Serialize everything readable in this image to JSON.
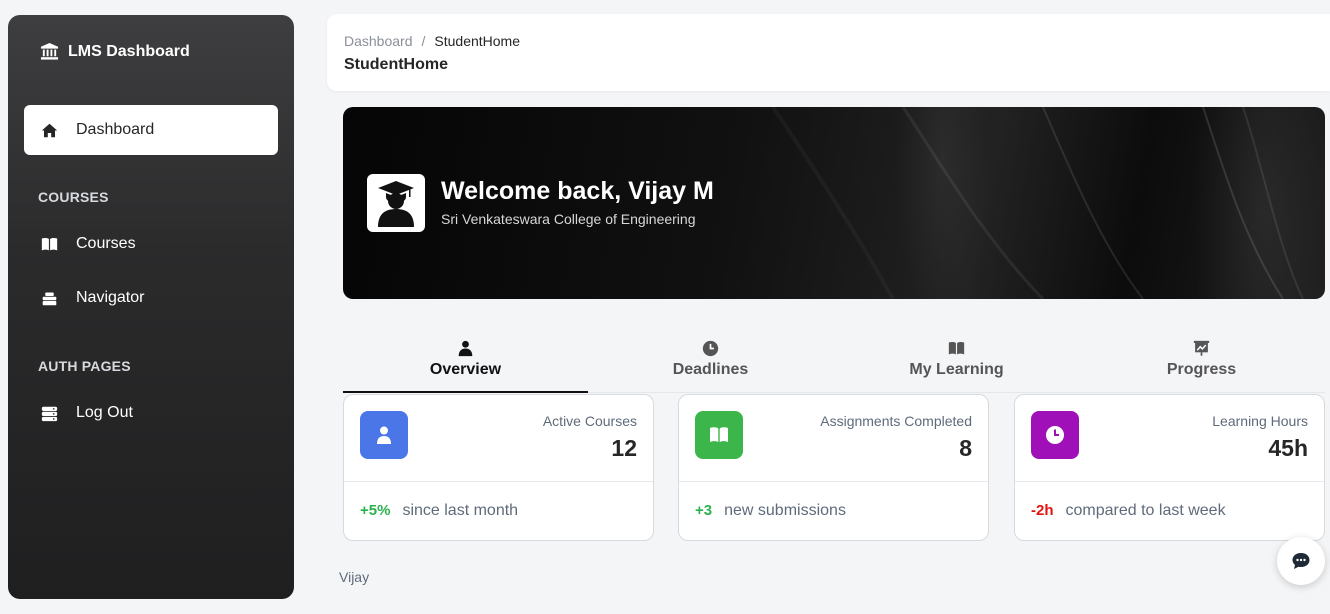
{
  "sidebar": {
    "brand": "LMS Dashboard",
    "items": [
      {
        "label": "Dashboard",
        "icon": "home-icon",
        "active": true
      },
      {
        "label": "Courses",
        "icon": "book-icon"
      },
      {
        "label": "Navigator",
        "icon": "stack-icon"
      },
      {
        "label": "Log Out",
        "icon": "database-icon"
      }
    ],
    "sections": [
      "COURSES",
      "AUTH PAGES"
    ]
  },
  "header": {
    "breadcrumb_root": "Dashboard",
    "breadcrumb_sep": "/",
    "breadcrumb_current": "StudentHome",
    "title": "StudentHome"
  },
  "hero": {
    "welcome": "Welcome back, Vijay M",
    "college": "Sri Venkateswara College of Engineering"
  },
  "tabs": [
    {
      "label": "Overview",
      "icon": "person-icon",
      "active": true
    },
    {
      "label": "Deadlines",
      "icon": "clock-icon"
    },
    {
      "label": "My Learning",
      "icon": "book-open-icon"
    },
    {
      "label": "Progress",
      "icon": "presentation-icon"
    }
  ],
  "cards": [
    {
      "label": "Active Courses",
      "value": "12",
      "delta": "+5%",
      "delta_color": "#2bb24c",
      "note": "since last month",
      "icon_bg": "#4a76e8"
    },
    {
      "label": "Assignments Completed",
      "value": "8",
      "delta": "+3",
      "delta_color": "#2bb24c",
      "note": "new submissions",
      "icon_bg": "#3cb54a"
    },
    {
      "label": "Learning Hours",
      "value": "45h",
      "delta": "-2h",
      "delta_color": "#e3130f",
      "note": "compared to last week",
      "icon_bg": "#a010b8"
    }
  ],
  "footer": {
    "user": "Vijay"
  }
}
